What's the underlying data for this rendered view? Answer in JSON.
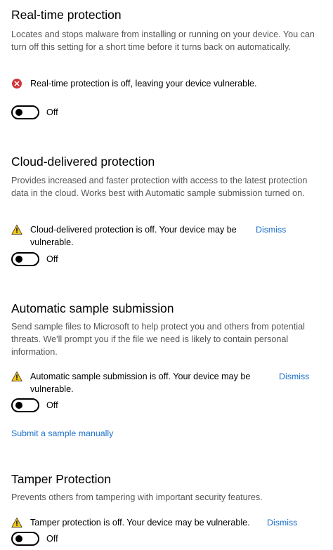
{
  "realtime": {
    "title": "Real-time protection",
    "description": "Locates and stops malware from installing or running on your device. You can turn off this setting for a short time before it turns back on automatically.",
    "status_text": "Real-time protection is off, leaving your device vulnerable.",
    "status_icon": "error-icon",
    "status_color": "#d13438",
    "toggle_label": "Off",
    "toggle_state": "off"
  },
  "cloud": {
    "title": "Cloud-delivered protection",
    "description": "Provides increased and faster protection with access to the latest protection data in the cloud. Works best with Automatic sample submission turned on.",
    "status_text": "Cloud-delivered protection is off. Your device may be vulnerable.",
    "status_icon": "warning-icon",
    "warning_color": "#f0c419",
    "dismiss_label": "Dismiss",
    "toggle_label": "Off",
    "toggle_state": "off"
  },
  "sample": {
    "title": "Automatic sample submission",
    "description": "Send sample files to Microsoft to help protect you and others from potential threats. We'll prompt you if the file we need is likely to contain personal information.",
    "status_text": "Automatic sample submission is off. Your device may be vulnerable.",
    "status_icon": "warning-icon",
    "dismiss_label": "Dismiss",
    "toggle_label": "Off",
    "toggle_state": "off",
    "manual_link": "Submit a sample manually"
  },
  "tamper": {
    "title": "Tamper Protection",
    "description": "Prevents others from tampering with important security features.",
    "status_text": "Tamper protection is off. Your device may be vulnerable.",
    "status_icon": "warning-icon",
    "dismiss_label": "Dismiss",
    "toggle_label": "Off",
    "toggle_state": "off"
  },
  "colors": {
    "link": "#1a6fc9",
    "description_text": "#555555"
  }
}
